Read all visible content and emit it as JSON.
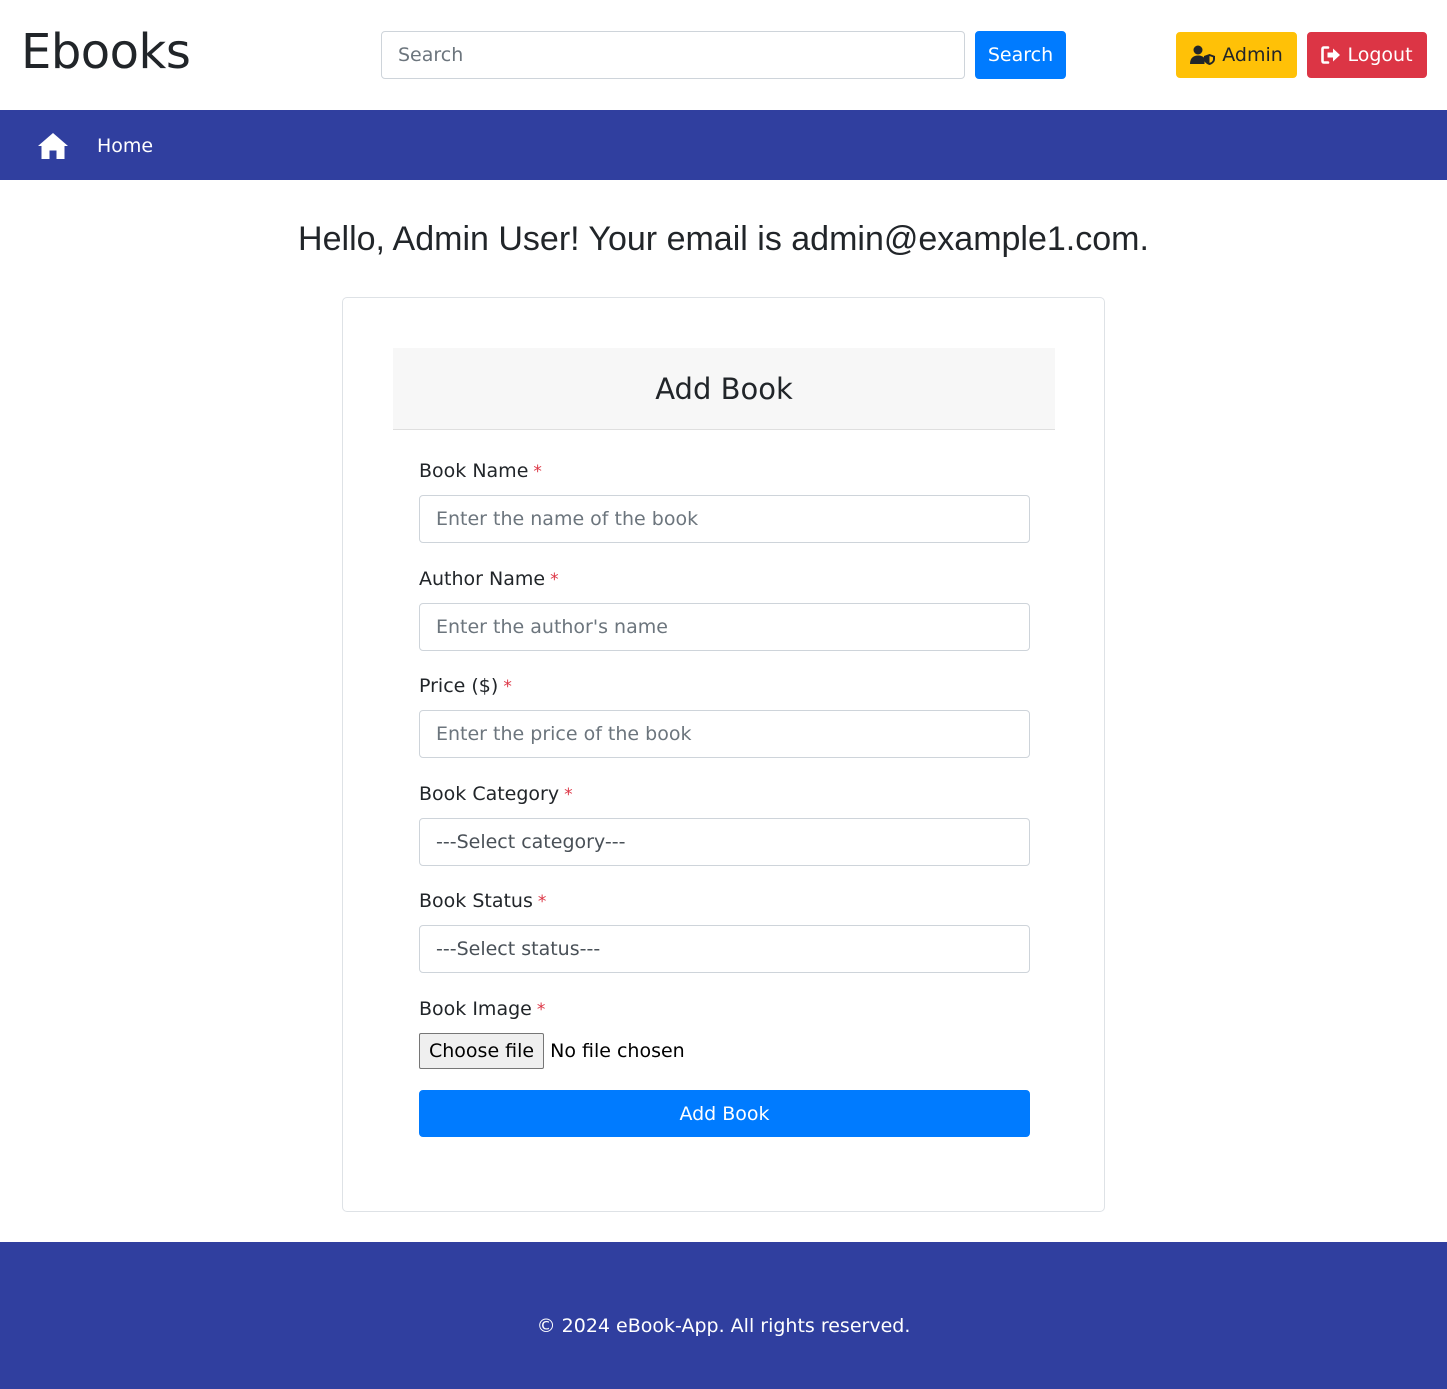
{
  "header": {
    "brand": "Ebooks",
    "search": {
      "placeholder": "Search",
      "value": ""
    },
    "search_button": "Search",
    "admin_button": {
      "label": "Admin",
      "icon": "user-shield-icon"
    },
    "logout_button": {
      "label": "Logout",
      "icon": "sign-out-icon"
    }
  },
  "navbar": {
    "home_icon": "home-icon",
    "home_label": "Home"
  },
  "greeting": "Hello, Admin User! Your email is admin@example1.com.",
  "form": {
    "title": "Add Book",
    "required_marker": "*",
    "fields": [
      {
        "label": "Book Name",
        "placeholder": "Enter the name of the book",
        "type": "text"
      },
      {
        "label": "Author Name",
        "placeholder": "Enter the author's name",
        "type": "text"
      },
      {
        "label": "Price ($)",
        "placeholder": "Enter the price of the book",
        "type": "text"
      },
      {
        "label": "Book Category",
        "selected": "---Select category---",
        "type": "select"
      },
      {
        "label": "Book Status",
        "selected": "---Select status---",
        "type": "select"
      },
      {
        "label": "Book Image",
        "type": "file",
        "button": "Choose file",
        "status": "No file chosen"
      }
    ],
    "submit": "Add Book"
  },
  "footer": {
    "text": "© 2024 eBook-App. All rights reserved."
  },
  "colors": {
    "primary": "#007bff",
    "warning": "#ffc107",
    "danger": "#dc3545",
    "nav": "#303f9f",
    "required": "#dc3545"
  }
}
